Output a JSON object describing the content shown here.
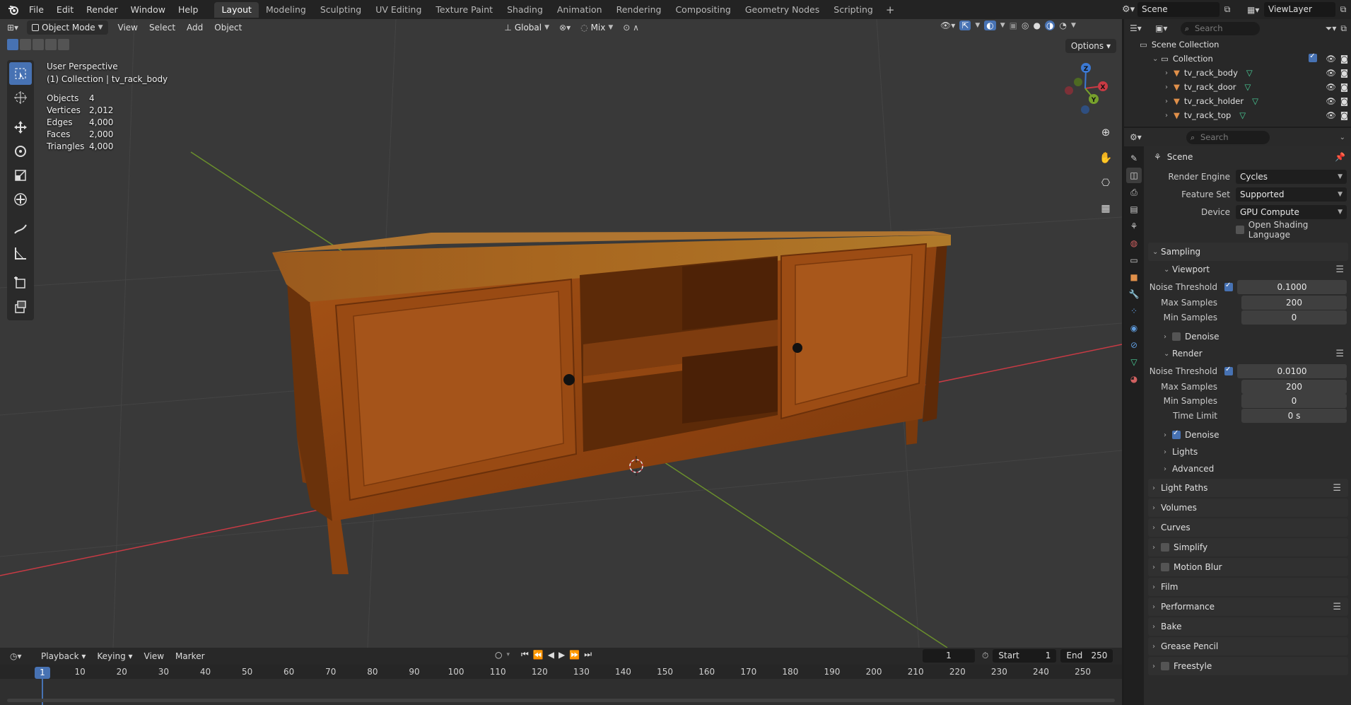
{
  "topbar": {
    "menus": [
      "File",
      "Edit",
      "Render",
      "Window",
      "Help"
    ],
    "workspaces": [
      "Layout",
      "Modeling",
      "Sculpting",
      "UV Editing",
      "Texture Paint",
      "Shading",
      "Animation",
      "Rendering",
      "Compositing",
      "Geometry Nodes",
      "Scripting"
    ],
    "active_workspace": "Layout",
    "add_tab": "+",
    "scene": "Scene",
    "view_layer": "ViewLayer"
  },
  "viewport": {
    "mode": "Object Mode",
    "menus": [
      "View",
      "Select",
      "Add",
      "Object"
    ],
    "orientation": "Global",
    "snap_mode": "Mix",
    "options": "Options",
    "overlay": {
      "perspective": "User Perspective",
      "context": "(1) Collection | tv_rack_body",
      "stats": [
        {
          "label": "Objects",
          "value": "4"
        },
        {
          "label": "Vertices",
          "value": "2,012"
        },
        {
          "label": "Edges",
          "value": "4,000"
        },
        {
          "label": "Faces",
          "value": "2,000"
        },
        {
          "label": "Triangles",
          "value": "4,000"
        }
      ]
    },
    "gizmo": {
      "x": "X",
      "y": "Y",
      "z": "Z"
    },
    "colors": {
      "bg": "#393939",
      "x_axis": "#c83a44",
      "y_axis": "#77a12c",
      "z_axis": "#3b79d4",
      "wood": "#9b4a14"
    }
  },
  "timeline": {
    "menus": [
      "Playback",
      "Keying",
      "View",
      "Marker"
    ],
    "current_frame": "1",
    "start_label": "Start",
    "start": "1",
    "end_label": "End",
    "end": "250",
    "ticks": [
      "1",
      "10",
      "20",
      "30",
      "40",
      "50",
      "60",
      "70",
      "80",
      "90",
      "100",
      "110",
      "120",
      "130",
      "140",
      "150",
      "160",
      "170",
      "180",
      "190",
      "200",
      "210",
      "220",
      "230",
      "240",
      "250"
    ]
  },
  "outliner": {
    "search_placeholder": "Search",
    "scene_collection": "Scene Collection",
    "collection": "Collection",
    "objects": [
      "tv_rack_body",
      "tv_rack_door",
      "tv_rack_holder",
      "tv_rack_top"
    ]
  },
  "properties": {
    "search_placeholder": "Search",
    "scene_title": "Scene",
    "render_engine_label": "Render Engine",
    "render_engine": "Cycles",
    "feature_set_label": "Feature Set",
    "feature_set": "Supported",
    "device_label": "Device",
    "device": "GPU Compute",
    "osl_label": "Open Shading Language",
    "sampling": "Sampling",
    "viewport_sub": "Viewport",
    "noise_threshold_label": "Noise Threshold",
    "viewport_noise": "0.1000",
    "max_samples_label": "Max Samples",
    "viewport_max": "200",
    "min_samples_label": "Min Samples",
    "viewport_min": "0",
    "denoise_label": "Denoise",
    "render_sub": "Render",
    "render_noise": "0.0100",
    "render_max": "200",
    "render_min": "0",
    "time_limit_label": "Time Limit",
    "time_limit": "0 s",
    "render_denoise_label": "Denoise",
    "lights": "Lights",
    "advanced": "Advanced",
    "panels": [
      "Light Paths",
      "Volumes",
      "Curves",
      "Simplify",
      "Motion Blur",
      "Film",
      "Performance",
      "Bake",
      "Grease Pencil",
      "Freestyle"
    ]
  }
}
